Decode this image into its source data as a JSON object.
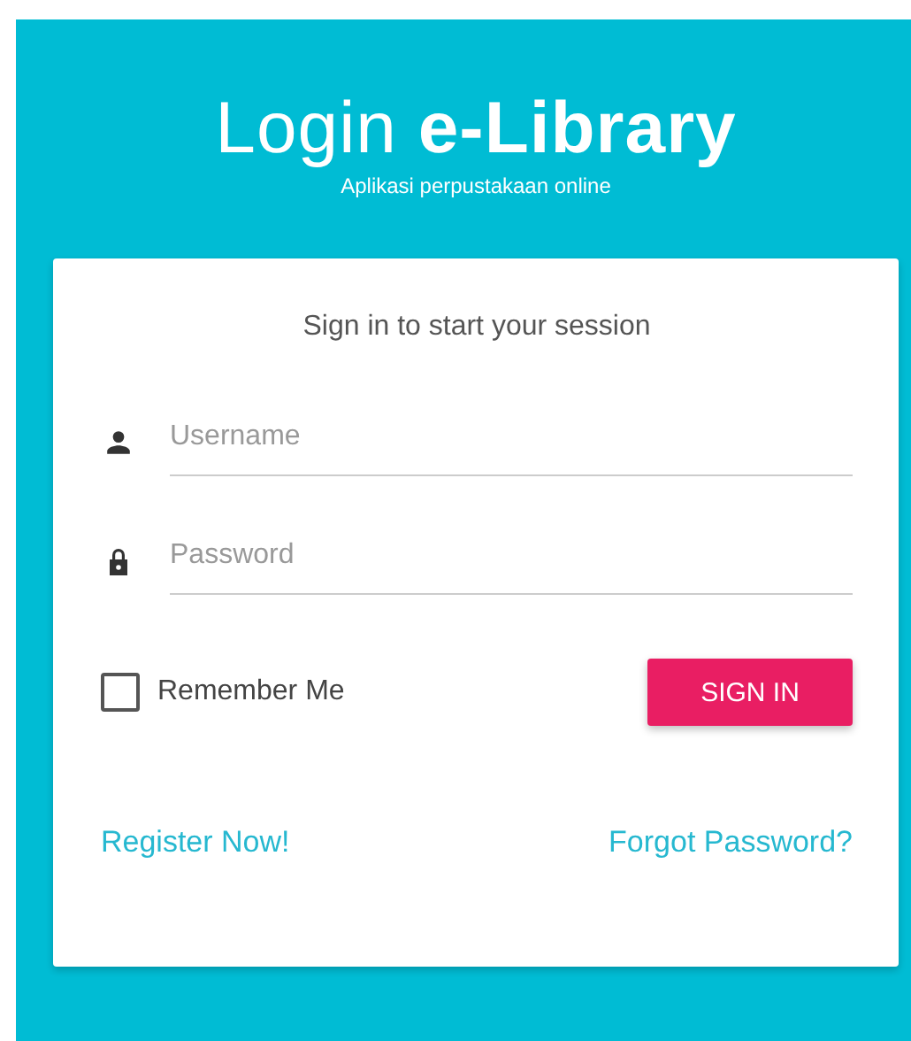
{
  "header": {
    "title": "Login **e-Library**",
    "subtitle": "Aplikasi perpustakaan online"
  },
  "card": {
    "message": "Sign in to start your session",
    "fields": [
      {
        "kind": "user",
        "placeholder": "Username"
      },
      {
        "kind": "lock",
        "placeholder": "Password"
      }
    ],
    "remember": {
      "label": "Remember Me",
      "checked": false
    },
    "submit": "SIGN IN",
    "links": [
      "Register Now!",
      "Forgot Password?"
    ]
  }
}
